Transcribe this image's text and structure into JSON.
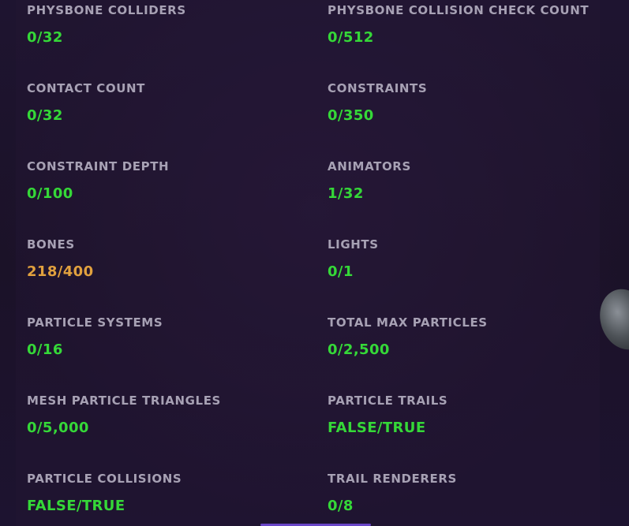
{
  "colors": {
    "good": "#35d838",
    "warn": "#e1a13e",
    "label": "#a7a1b4"
  },
  "stats": [
    {
      "label": "PHYSBONE COLLIDERS",
      "value": "0/32",
      "status": "good"
    },
    {
      "label": "PHYSBONE COLLISION CHECK COUNT",
      "value": "0/512",
      "status": "good"
    },
    {
      "label": "CONTACT COUNT",
      "value": "0/32",
      "status": "good"
    },
    {
      "label": "CONSTRAINTS",
      "value": "0/350",
      "status": "good"
    },
    {
      "label": "CONSTRAINT DEPTH",
      "value": "0/100",
      "status": "good"
    },
    {
      "label": "ANIMATORS",
      "value": "1/32",
      "status": "good"
    },
    {
      "label": "BONES",
      "value": "218/400",
      "status": "warn"
    },
    {
      "label": "LIGHTS",
      "value": "0/1",
      "status": "good"
    },
    {
      "label": "PARTICLE SYSTEMS",
      "value": "0/16",
      "status": "good"
    },
    {
      "label": "TOTAL MAX PARTICLES",
      "value": "0/2,500",
      "status": "good"
    },
    {
      "label": "MESH PARTICLE TRIANGLES",
      "value": "0/5,000",
      "status": "good"
    },
    {
      "label": "PARTICLE TRAILS",
      "value": "FALSE/TRUE",
      "status": "good"
    },
    {
      "label": "PARTICLE COLLISIONS",
      "value": "FALSE/TRUE",
      "status": "good"
    },
    {
      "label": "TRAIL RENDERERS",
      "value": "0/8",
      "status": "good"
    }
  ]
}
